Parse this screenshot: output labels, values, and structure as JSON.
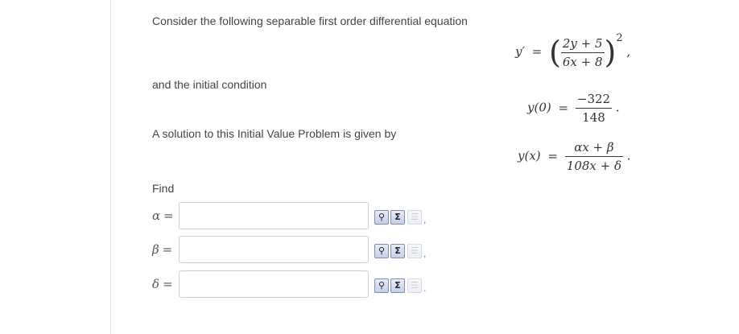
{
  "problem": {
    "intro": "Consider the following separable first order differential equation",
    "initial_condition_label": "and the initial condition",
    "solution_label": "A solution to this Initial Value Problem is given by",
    "find_label": "Find"
  },
  "equation": {
    "lhs": "y′",
    "eq": "=",
    "num": "2y + 5",
    "den": "6x + 8",
    "power": "2",
    "trail": ","
  },
  "initial": {
    "lhs": "y(0)",
    "eq": "=",
    "num": "−322",
    "den": "148",
    "trail": "."
  },
  "solution": {
    "lhs": "y(x)",
    "eq": "=",
    "num": "αx + β",
    "den": "108x + δ",
    "trail": "."
  },
  "answers": [
    {
      "symbol": "α",
      "eq": "=",
      "value": "",
      "punct": ","
    },
    {
      "symbol": "β",
      "eq": "=",
      "value": "",
      "punct": ","
    },
    {
      "symbol": "δ",
      "eq": "=",
      "value": "",
      "punct": "."
    }
  ],
  "tools": {
    "preview_icon": "preview-icon",
    "equation_icon": "sigma-icon",
    "help_icon": "help-page-icon",
    "sigma_glyph": "Σ"
  },
  "colors": {
    "tool_border": "#7f8fb8",
    "input_border": "#cfcfcf"
  }
}
